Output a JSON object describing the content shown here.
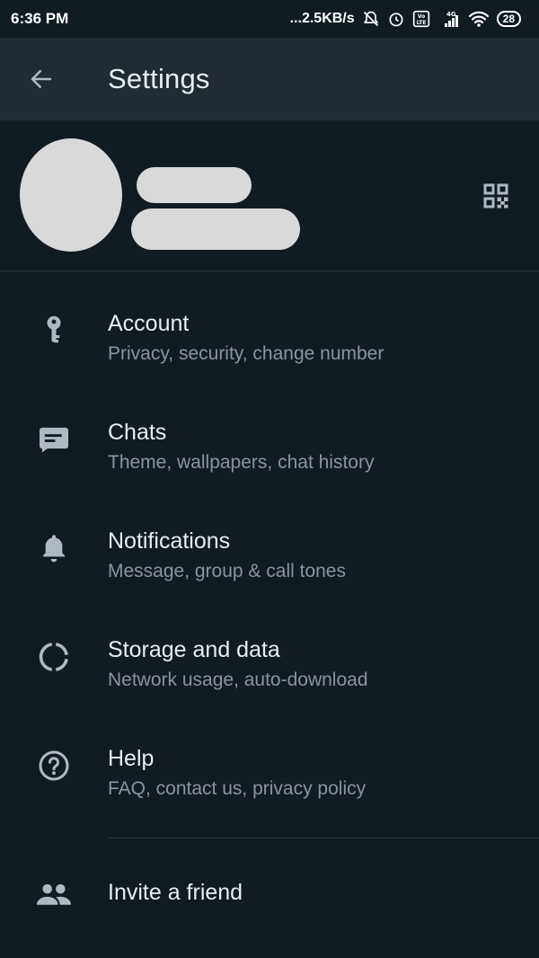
{
  "status_bar": {
    "time": "6:36 PM",
    "network_speed": "...2.5KB/s",
    "volte": "Vo LTE",
    "network_type": "4G",
    "battery": "28",
    "icons": [
      "mute-icon",
      "alarm-icon",
      "volte-icon",
      "signal-icon",
      "wifi-icon",
      "battery-icon"
    ]
  },
  "app_bar": {
    "title": "Settings",
    "back_icon": "arrow-left-icon"
  },
  "profile": {
    "about_visible_fragment": "~~ ~~~~~~ ~",
    "qr_icon": "qr-code-icon"
  },
  "settings": [
    {
      "title": "Account",
      "subtitle": "Privacy, security, change number",
      "icon": "key-icon"
    },
    {
      "title": "Chats",
      "subtitle": "Theme, wallpapers, chat history",
      "icon": "chat-icon"
    },
    {
      "title": "Notifications",
      "subtitle": "Message, group & call tones",
      "icon": "bell-icon"
    },
    {
      "title": "Storage and data",
      "subtitle": "Network usage, auto-download",
      "icon": "storage-icon"
    },
    {
      "title": "Help",
      "subtitle": "FAQ, contact us, privacy policy",
      "icon": "help-icon"
    }
  ],
  "invite": {
    "title": "Invite a friend",
    "icon": "people-icon"
  },
  "colors": {
    "background": "#111b22",
    "app_bar": "#202c33",
    "primary_text": "#e9edef",
    "secondary_text": "#8696a0",
    "icon": "#aebac1"
  }
}
